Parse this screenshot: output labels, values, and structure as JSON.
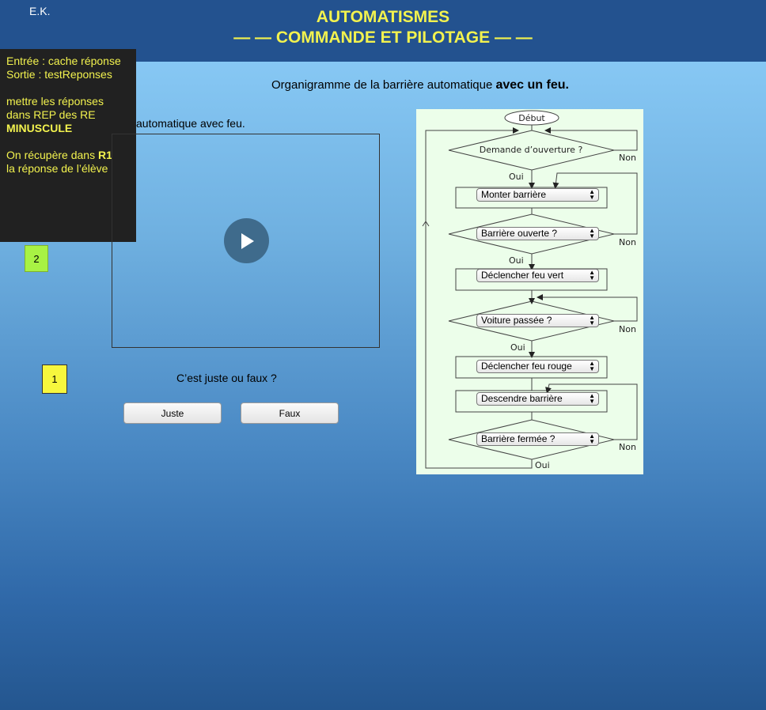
{
  "header": {
    "author": "E.K.",
    "title_line1": "AUTOMATISMES",
    "title_line2": "— — COMMANDE ET PILOTAGE — —",
    "background": "#23528f",
    "title_color": "#f2f24e"
  },
  "notes": {
    "line1": "Entrée : cache réponse",
    "line2": "Sortie : testReponses",
    "line3": "mettre les réponses",
    "line4": "dans REP des RE",
    "line5": "MINUSCULE",
    "line6_prefix": "On récupère dans ",
    "line6_bold": "R1",
    "line7": "la réponse de l’élève"
  },
  "main": {
    "subtitle_prefix": "Organigramme de la barrière automatique ",
    "subtitle_bold": "avec un feu.",
    "video_caption": "automatique avec feu.",
    "badge_2": "2",
    "badge_1": "1",
    "question": "C’est juste ou faux ?",
    "btn_juste": "Juste",
    "btn_faux": "Faux"
  },
  "flowchart": {
    "start": "Début",
    "demande": "Demande d’ouverture ?",
    "oui": "Oui",
    "non": "Non",
    "step1": "Monter barrière",
    "test1": "Barrière ouverte ?",
    "step2": "Déclencher feu vert",
    "test2": "Voiture passée ?",
    "step3": "Déclencher feu rouge",
    "step4": "Descendre barrière",
    "test3": "Barrière fermée ?",
    "background": "#ecfeea"
  }
}
